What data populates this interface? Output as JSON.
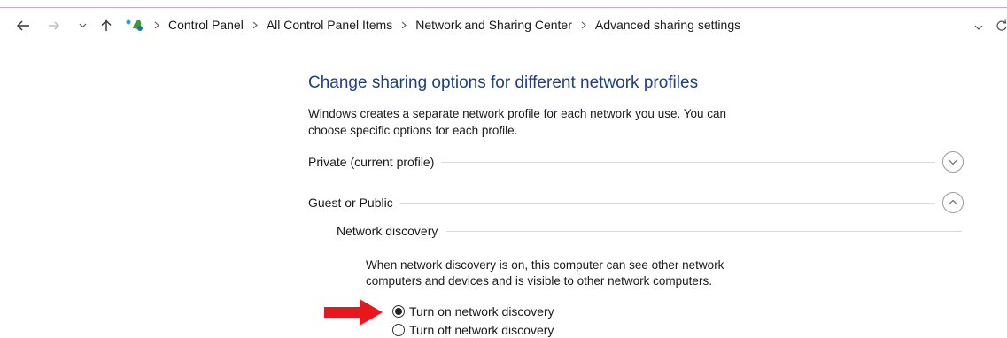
{
  "navigation": {
    "back_icon": "left-arrow",
    "forward_icon": "right-arrow",
    "recent_icon": "chevron-down",
    "up_icon": "up-arrow",
    "location_icon": "network-center-icon",
    "breadcrumb": [
      "Control Panel",
      "All Control Panel Items",
      "Network and Sharing Center",
      "Advanced sharing settings"
    ],
    "address_dropdown_icon": "chevron-down",
    "refresh_icon": "refresh"
  },
  "main": {
    "heading": "Change sharing options for different network profiles",
    "intro": "Windows creates a separate network profile for each network you use. You can choose specific options for each profile.",
    "profiles": [
      {
        "label": "Private (current profile)",
        "state": "collapsed"
      },
      {
        "label": "Guest or Public",
        "state": "expanded"
      }
    ],
    "network_discovery": {
      "title": "Network discovery",
      "description": "When network discovery is on, this computer can see other network computers and devices and is visible to other network computers.",
      "options": [
        {
          "label": "Turn on network discovery",
          "selected": true
        },
        {
          "label": "Turn off network discovery",
          "selected": false
        }
      ]
    }
  },
  "annotation": {
    "arrow_color": "#e8171b"
  },
  "colors": {
    "heading": "#1e3f86",
    "separator": "#d9d9d9"
  }
}
